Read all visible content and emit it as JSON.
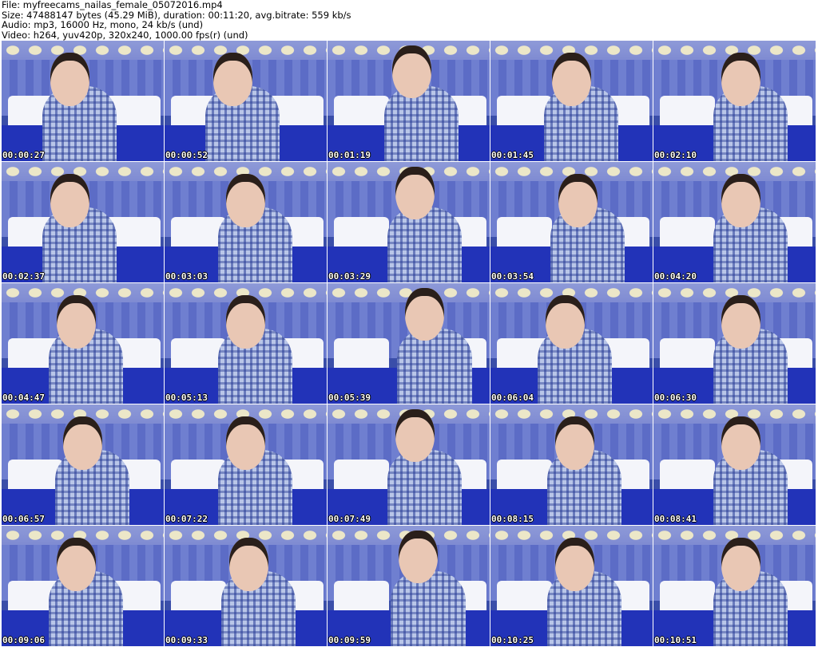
{
  "header": {
    "file_line": "File: myfreecams_nailas_female_05072016.mp4",
    "size_line": "Size: 47488147 bytes (45.29 MiB), duration: 00:11:20, avg.bitrate: 559 kb/s",
    "audio_line": "Audio: mp3, 16000 Hz, mono, 24 kb/s (und)",
    "video_line": "Video: h264, yuv420p, 320x240, 1000.00 fps(r) (und)"
  },
  "thumbnails": [
    {
      "timestamp": "00:00:27"
    },
    {
      "timestamp": "00:00:52"
    },
    {
      "timestamp": "00:01:19"
    },
    {
      "timestamp": "00:01:45"
    },
    {
      "timestamp": "00:02:10"
    },
    {
      "timestamp": "00:02:37"
    },
    {
      "timestamp": "00:03:03"
    },
    {
      "timestamp": "00:03:29"
    },
    {
      "timestamp": "00:03:54"
    },
    {
      "timestamp": "00:04:20"
    },
    {
      "timestamp": "00:04:47"
    },
    {
      "timestamp": "00:05:13"
    },
    {
      "timestamp": "00:05:39"
    },
    {
      "timestamp": "00:06:04"
    },
    {
      "timestamp": "00:06:30"
    },
    {
      "timestamp": "00:06:57"
    },
    {
      "timestamp": "00:07:22"
    },
    {
      "timestamp": "00:07:49"
    },
    {
      "timestamp": "00:08:15"
    },
    {
      "timestamp": "00:08:41"
    },
    {
      "timestamp": "00:09:06"
    },
    {
      "timestamp": "00:09:33"
    },
    {
      "timestamp": "00:09:59"
    },
    {
      "timestamp": "00:10:25"
    },
    {
      "timestamp": "00:10:51"
    }
  ]
}
